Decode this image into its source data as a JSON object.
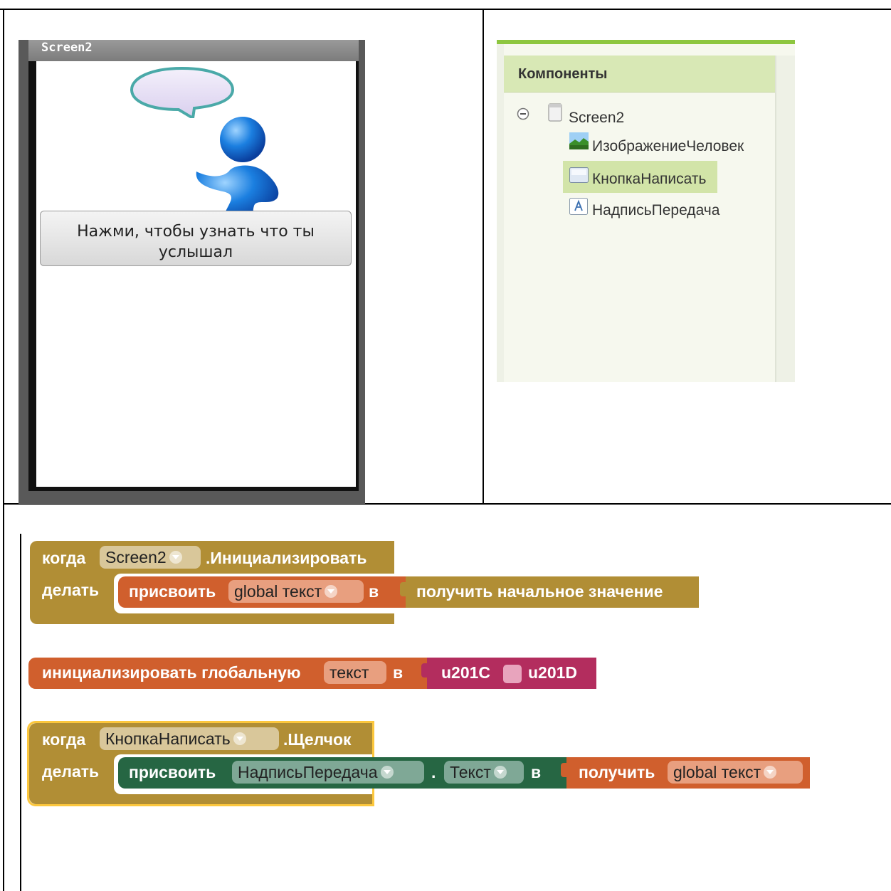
{
  "phone": {
    "title": "Screen2",
    "button_label_line1": "Нажми,  чтобы узнать что ты",
    "button_label_line2": "услышал"
  },
  "components": {
    "header": "Компоненты",
    "items": [
      {
        "label": "Screen2",
        "icon": "screen-icon"
      },
      {
        "label": "ИзображениеЧеловек",
        "icon": "image-icon"
      },
      {
        "label": "КнопкаНаписать",
        "icon": "button-icon"
      },
      {
        "label": "НадписьПередача",
        "icon": "label-icon"
      }
    ]
  },
  "blocks": {
    "block1": {
      "when": "когда",
      "component": "Screen2",
      "event": ".Инициализировать",
      "do": "делать",
      "set": "присвоить",
      "var": "global текст",
      "to": "в",
      "value": "получить начальное значение"
    },
    "block2": {
      "init": "инициализировать глобальную",
      "name": "текст",
      "to": "в",
      "text1": "u201C",
      "text2": "u201D"
    },
    "block3": {
      "when": "когда",
      "component": "КнопкаНаписать",
      "event": ".Щелчок",
      "do": "делать",
      "set": "присвоить",
      "target": "НадписьПередача",
      "dot": ".",
      "prop": "Текст",
      "to": "в",
      "get": "получить",
      "var": "global текст"
    }
  },
  "colors": {
    "event_block": "#b18e35",
    "var_block": "#d05f2d",
    "text_block": "#b32d5e",
    "component_block": "#266643",
    "selected_outline": "#fcc73d"
  }
}
